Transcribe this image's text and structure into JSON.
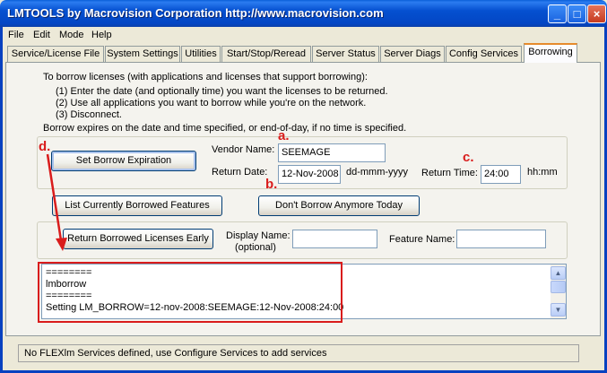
{
  "window": {
    "title": "LMTOOLS by Macrovision Corporation http://www.macrovision.com"
  },
  "menu": [
    "File",
    "Edit",
    "Mode",
    "Help"
  ],
  "tabs": [
    "Service/License File",
    "System Settings",
    "Utilities",
    "Start/Stop/Reread",
    "Server Status",
    "Server Diags",
    "Config Services",
    "Borrowing"
  ],
  "active_tab": "Borrowing",
  "instructions": {
    "intro": "To borrow licenses (with applications and licenses that support borrowing):",
    "step1": "(1) Enter the date (and optionally time) you want the licenses to be returned.",
    "step2": "(2) Use all applications you want to borrow while you're on the network.",
    "step3": "(3) Disconnect.",
    "expiry": "Borrow expires on the date and time specified, or end-of-day, if no time is specified."
  },
  "borrow_form": {
    "set_expiration_button": "Set Borrow Expiration",
    "vendor_name_label": "Vendor Name:",
    "vendor_name_value": "SEEMAGE",
    "return_date_label": "Return Date:",
    "return_date_value": "12-Nov-2008",
    "date_format": "dd-mmm-yyyy",
    "return_time_label": "Return Time:",
    "return_time_value": "24:00",
    "time_format": "hh:mm"
  },
  "actions": {
    "list_borrowed_button": "List Currently Borrowed Features",
    "dont_borrow_button": "Don't Borrow Anymore Today"
  },
  "return_section": {
    "return_early_button": "Return Borrowed Licenses Early",
    "display_name_label": "Display Name:",
    "display_name_sublabel": "(optional)",
    "display_name_value": "",
    "feature_name_label": "Feature Name:",
    "feature_name_value": ""
  },
  "output": {
    "line1": "========",
    "line2": "lmborrow",
    "line3": "========",
    "line4": "Setting LM_BORROW=12-nov-2008:SEEMAGE:12-Nov-2008:24:00"
  },
  "annotations": {
    "a": "a.",
    "b": "b.",
    "c": "c.",
    "d": "d."
  },
  "status": "No FLEXlm Services defined, use Configure Services to add services",
  "colors": {
    "title_bar": "#0550d0",
    "annotation_red": "#d91c1c",
    "active_tab_accent": "#e68b2c"
  }
}
